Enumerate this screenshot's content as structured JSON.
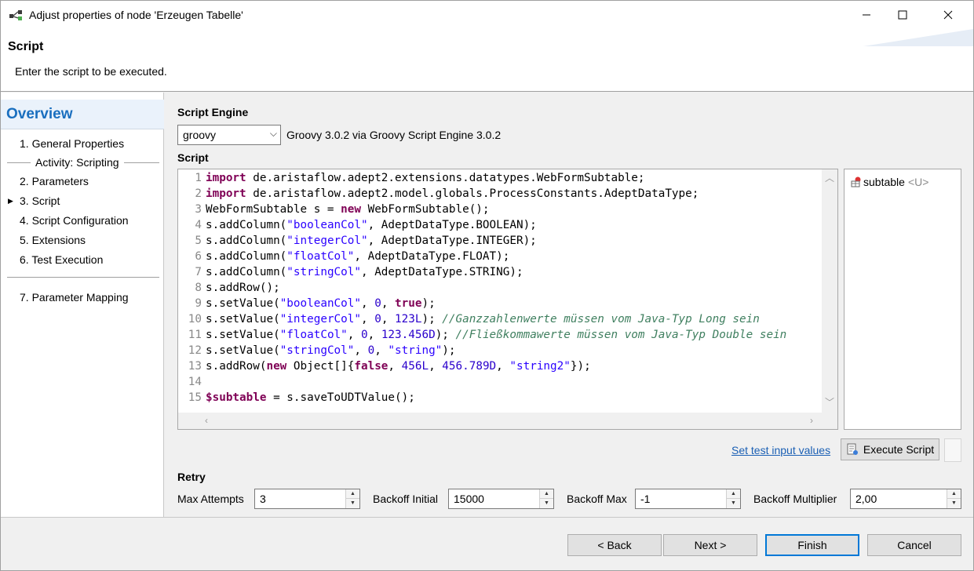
{
  "window": {
    "title": "Adjust properties of node 'Erzeugen Tabelle'"
  },
  "header": {
    "title": "Script",
    "description": "Enter the script to be executed."
  },
  "nav": {
    "heading": "Overview",
    "items": [
      {
        "label": "1.  General Properties"
      },
      {
        "label": "2.  Parameters"
      },
      {
        "label": "3.  Script",
        "selected": true
      },
      {
        "label": "4.  Script Configuration"
      },
      {
        "label": "5.  Extensions"
      },
      {
        "label": "6.  Test Execution"
      },
      {
        "label": "7.  Parameter Mapping"
      }
    ],
    "group_label": "Activity: Scripting"
  },
  "engine": {
    "label": "Script Engine",
    "selected": "groovy",
    "description": "Groovy 3.0.2 via Groovy Script Engine 3.0.2"
  },
  "script": {
    "label": "Script",
    "line_numbers": [
      "1",
      "2",
      "3",
      "4",
      "5",
      "6",
      "7",
      "8",
      "9",
      "10",
      "11",
      "12",
      "13",
      "14",
      "15"
    ]
  },
  "variables": [
    {
      "name": "subtable",
      "type": "<U>"
    }
  ],
  "test": {
    "link": "Set test input values",
    "execute": "Execute Script"
  },
  "retry": {
    "label": "Retry",
    "max_attempts_label": "Max Attempts",
    "max_attempts": "3",
    "backoff_initial_label": "Backoff Initial",
    "backoff_initial": "15000",
    "backoff_max_label": "Backoff Max",
    "backoff_max": "-1",
    "backoff_multiplier_label": "Backoff Multiplier",
    "backoff_multiplier": "2,00"
  },
  "buttons": {
    "back": "< Back",
    "next": "Next >",
    "finish": "Finish",
    "cancel": "Cancel"
  },
  "colors": {
    "accent": "#0078d7",
    "keyword": "#7f0055",
    "string": "#2a00ff",
    "comment": "#3f7f5f",
    "link": "#1a5fb4"
  },
  "code_lines": [
    [
      [
        "kw",
        "import"
      ],
      [
        "t",
        " de.aristaflow.adept2.extensions.datatypes.WebFormSubtable;"
      ]
    ],
    [
      [
        "kw",
        "import"
      ],
      [
        "t",
        " de.aristaflow.adept2.model.globals.ProcessConstants.AdeptDataType;"
      ]
    ],
    [
      [
        "t",
        "WebFormSubtable s = "
      ],
      [
        "kw",
        "new"
      ],
      [
        "t",
        " WebFormSubtable();"
      ]
    ],
    [
      [
        "t",
        "s.addColumn("
      ],
      [
        "str",
        "\"booleanCol\""
      ],
      [
        "t",
        ", AdeptDataType.BOOLEAN);"
      ]
    ],
    [
      [
        "t",
        "s.addColumn("
      ],
      [
        "str",
        "\"integerCol\""
      ],
      [
        "t",
        ", AdeptDataType.INTEGER);"
      ]
    ],
    [
      [
        "t",
        "s.addColumn("
      ],
      [
        "str",
        "\"floatCol\""
      ],
      [
        "t",
        ", AdeptDataType.FLOAT);"
      ]
    ],
    [
      [
        "t",
        "s.addColumn("
      ],
      [
        "str",
        "\"stringCol\""
      ],
      [
        "t",
        ", AdeptDataType.STRING);"
      ]
    ],
    [
      [
        "t",
        "s.addRow();"
      ]
    ],
    [
      [
        "t",
        "s.setValue("
      ],
      [
        "str",
        "\"booleanCol\""
      ],
      [
        "t",
        ", "
      ],
      [
        "num",
        "0"
      ],
      [
        "t",
        ", "
      ],
      [
        "kw",
        "true"
      ],
      [
        "t",
        ");"
      ]
    ],
    [
      [
        "t",
        "s.setValue("
      ],
      [
        "str",
        "\"integerCol\""
      ],
      [
        "t",
        ", "
      ],
      [
        "num",
        "0"
      ],
      [
        "t",
        ", "
      ],
      [
        "num",
        "123L"
      ],
      [
        "t",
        "); "
      ],
      [
        "cm",
        "//Ganzzahlenwerte müssen vom Java-Typ Long sein"
      ]
    ],
    [
      [
        "t",
        "s.setValue("
      ],
      [
        "str",
        "\"floatCol\""
      ],
      [
        "t",
        ", "
      ],
      [
        "num",
        "0"
      ],
      [
        "t",
        ", "
      ],
      [
        "num",
        "123.456D"
      ],
      [
        "t",
        "); "
      ],
      [
        "cm",
        "//Fließkommawerte müssen vom Java-Typ Double sein"
      ]
    ],
    [
      [
        "t",
        "s.setValue("
      ],
      [
        "str",
        "\"stringCol\""
      ],
      [
        "t",
        ", "
      ],
      [
        "num",
        "0"
      ],
      [
        "t",
        ", "
      ],
      [
        "str",
        "\"string\""
      ],
      [
        "t",
        ");"
      ]
    ],
    [
      [
        "t",
        "s.addRow("
      ],
      [
        "kw",
        "new"
      ],
      [
        "t",
        " Object[]{"
      ],
      [
        "kw",
        "false"
      ],
      [
        "t",
        ", "
      ],
      [
        "num",
        "456L"
      ],
      [
        "t",
        ", "
      ],
      [
        "num",
        "456.789D"
      ],
      [
        "t",
        ", "
      ],
      [
        "str",
        "\"string2\""
      ],
      [
        "t",
        "});"
      ]
    ],
    [],
    [
      [
        "var",
        "$subtable"
      ],
      [
        "t",
        " = s.saveToUDTValue();"
      ]
    ]
  ]
}
